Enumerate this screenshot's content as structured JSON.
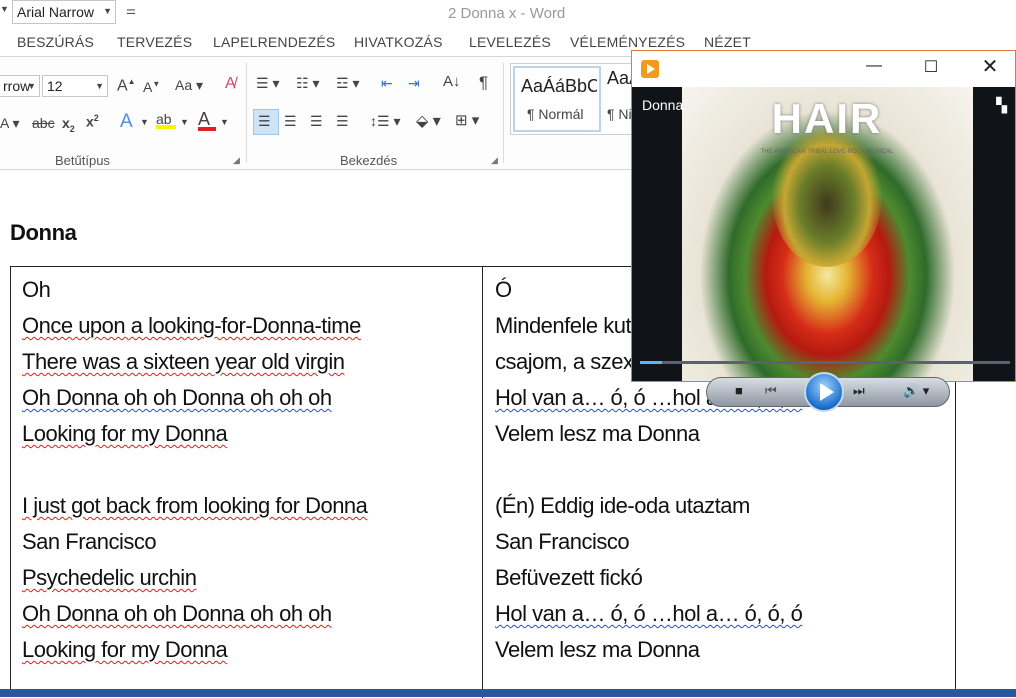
{
  "window": {
    "title": "2 Donna x - Word",
    "font_box": "Arial Narrow"
  },
  "ribbon_tabs": [
    "BESZÚRÁS",
    "TERVEZÉS",
    "LAPELRENDEZÉS",
    "HIVATKOZÁS",
    "LEVELEZÉS",
    "VÉLEMÉNYEZÉS",
    "NÉZET"
  ],
  "ribbon": {
    "font_combo": "rrow",
    "size_combo": "12",
    "font_group_label": "Betűtípus",
    "paragraph_group_label": "Bekezdés",
    "styles": [
      {
        "sample": "AaÁáBbCc",
        "name": "¶ Normál"
      },
      {
        "sample": "AaÁ",
        "name": "¶ Ni"
      }
    ]
  },
  "document": {
    "heading": "Donna",
    "left_lines": [
      "Oh",
      "Once upon a looking-for-Donna-time",
      "There was a sixteen year old virgin",
      "Oh Donna oh oh Donna oh oh oh",
      "Looking for my Donna",
      "",
      "I just got back from looking for Donna",
      "San Francisco",
      "Psychedelic urchin",
      "Oh Donna oh oh Donna oh oh oh",
      "Looking for my Donna"
    ],
    "right_lines": [
      "Ó",
      "Mindenfele kut",
      "csajom, a szex",
      "Hol van a… ó, ó …hol a… ó, ó, ó",
      "Velem lesz ma Donna",
      "",
      "(Én) Eddig ide-oda utaztam",
      "San Francisco",
      "Befüvezett fickó",
      "Hol van a… ó, ó …hol a… ó, ó, ó",
      "Velem lesz ma Donna"
    ]
  },
  "player": {
    "video_title": "Donna",
    "album_title": "HAIR",
    "album_subtitle": "THE AMERICAN TRIBAL LOVE-ROCK MUSICAL",
    "progress": 0.06
  },
  "colors": {
    "spelling_underline": "#e0201c",
    "grammar_underline": "#2b4fd0",
    "player_border": "#e07a3c",
    "taskbar": "#2b579a"
  }
}
